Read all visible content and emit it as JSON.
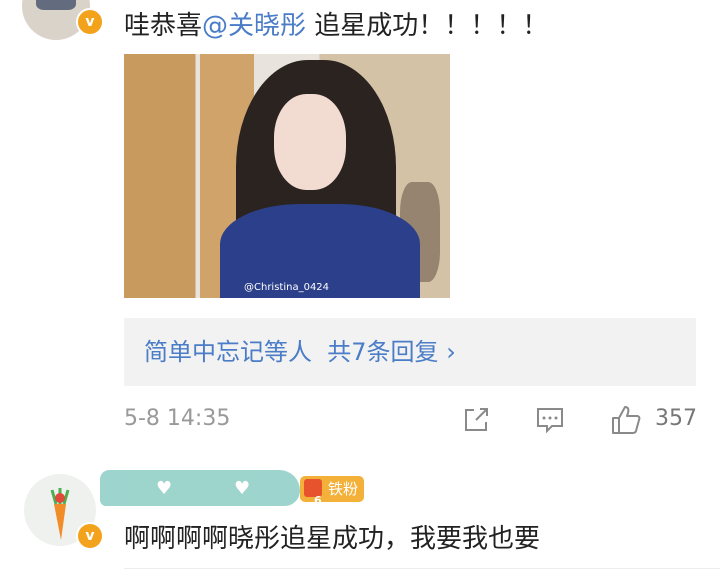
{
  "comment1": {
    "prefix": "哇恭喜",
    "mention": "@关晓彤",
    "suffix": " 追星成功！！！！！",
    "photo_watermark": "@Christina_0424",
    "replies_summary": {
      "names": "简单中忘记等人",
      "count_text": "共7条回复",
      "chevron": "›"
    },
    "timestamp": "5-8 14:35",
    "actions": {
      "share_icon": "share-icon",
      "comment_icon": "comment-icon",
      "like_icon": "thumbs-up-icon",
      "like_count": "357"
    }
  },
  "comment2": {
    "fan_badge_label": "铁粉",
    "fan_badge_level": "6",
    "text": "啊啊啊啊晓彤追星成功，我要我也要"
  },
  "verified_badge_glyph": "v",
  "colors": {
    "mention": "#4a7cc7",
    "badge": "#f3a21b",
    "fan_badge": "#f3b13a"
  }
}
